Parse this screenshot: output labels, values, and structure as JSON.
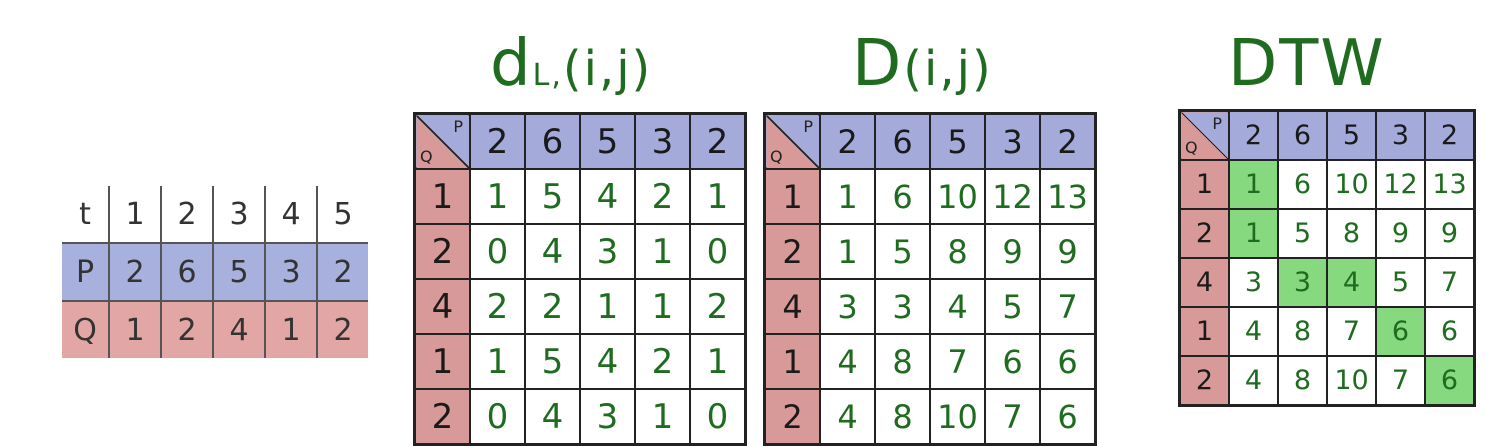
{
  "time_table": {
    "t_label": "t",
    "t": [
      "1",
      "2",
      "3",
      "4",
      "5"
    ],
    "p_label": "P",
    "p": [
      "2",
      "6",
      "5",
      "3",
      "2"
    ],
    "q_label": "Q",
    "q": [
      "1",
      "2",
      "4",
      "1",
      "2"
    ]
  },
  "corner": {
    "p": "P",
    "q": "Q"
  },
  "matrices": [
    {
      "title_main": "d",
      "title_sub": "L,",
      "title_rest": "(i,j)",
      "col_headers": [
        "2",
        "6",
        "5",
        "3",
        "2"
      ],
      "row_headers": [
        "1",
        "2",
        "4",
        "1",
        "2"
      ],
      "rows": [
        [
          "1",
          "5",
          "4",
          "2",
          "1"
        ],
        [
          "0",
          "4",
          "3",
          "1",
          "0"
        ],
        [
          "2",
          "2",
          "1",
          "1",
          "2"
        ],
        [
          "1",
          "5",
          "4",
          "2",
          "1"
        ],
        [
          "0",
          "4",
          "3",
          "1",
          "0"
        ]
      ]
    },
    {
      "title_main": "D",
      "title_sub": "",
      "title_rest": "(i,j)",
      "col_headers": [
        "2",
        "6",
        "5",
        "3",
        "2"
      ],
      "row_headers": [
        "1",
        "2",
        "4",
        "1",
        "2"
      ],
      "rows": [
        [
          "1",
          "6",
          "10",
          "12",
          "13"
        ],
        [
          "1",
          "5",
          "8",
          "9",
          "9"
        ],
        [
          "3",
          "3",
          "4",
          "5",
          "7"
        ],
        [
          "4",
          "8",
          "7",
          "6",
          "6"
        ],
        [
          "4",
          "8",
          "10",
          "7",
          "6"
        ]
      ]
    },
    {
      "title_main": "DTW",
      "title_sub": "",
      "title_rest": "",
      "col_headers": [
        "2",
        "6",
        "5",
        "3",
        "2"
      ],
      "row_headers": [
        "1",
        "2",
        "4",
        "1",
        "2"
      ],
      "rows": [
        [
          "1",
          "6",
          "10",
          "12",
          "13"
        ],
        [
          "1",
          "5",
          "8",
          "9",
          "9"
        ],
        [
          "3",
          "3",
          "4",
          "5",
          "7"
        ],
        [
          "4",
          "8",
          "7",
          "6",
          "6"
        ],
        [
          "4",
          "8",
          "10",
          "7",
          "6"
        ]
      ],
      "path": [
        [
          0,
          0
        ],
        [
          1,
          0
        ],
        [
          2,
          1
        ],
        [
          2,
          2
        ],
        [
          3,
          3
        ],
        [
          4,
          4
        ]
      ]
    }
  ],
  "colors": {
    "p_header": "#a4abdb",
    "q_header": "#d89a98",
    "values": "#1f6b1f",
    "path_highlight": "#86d97f"
  }
}
